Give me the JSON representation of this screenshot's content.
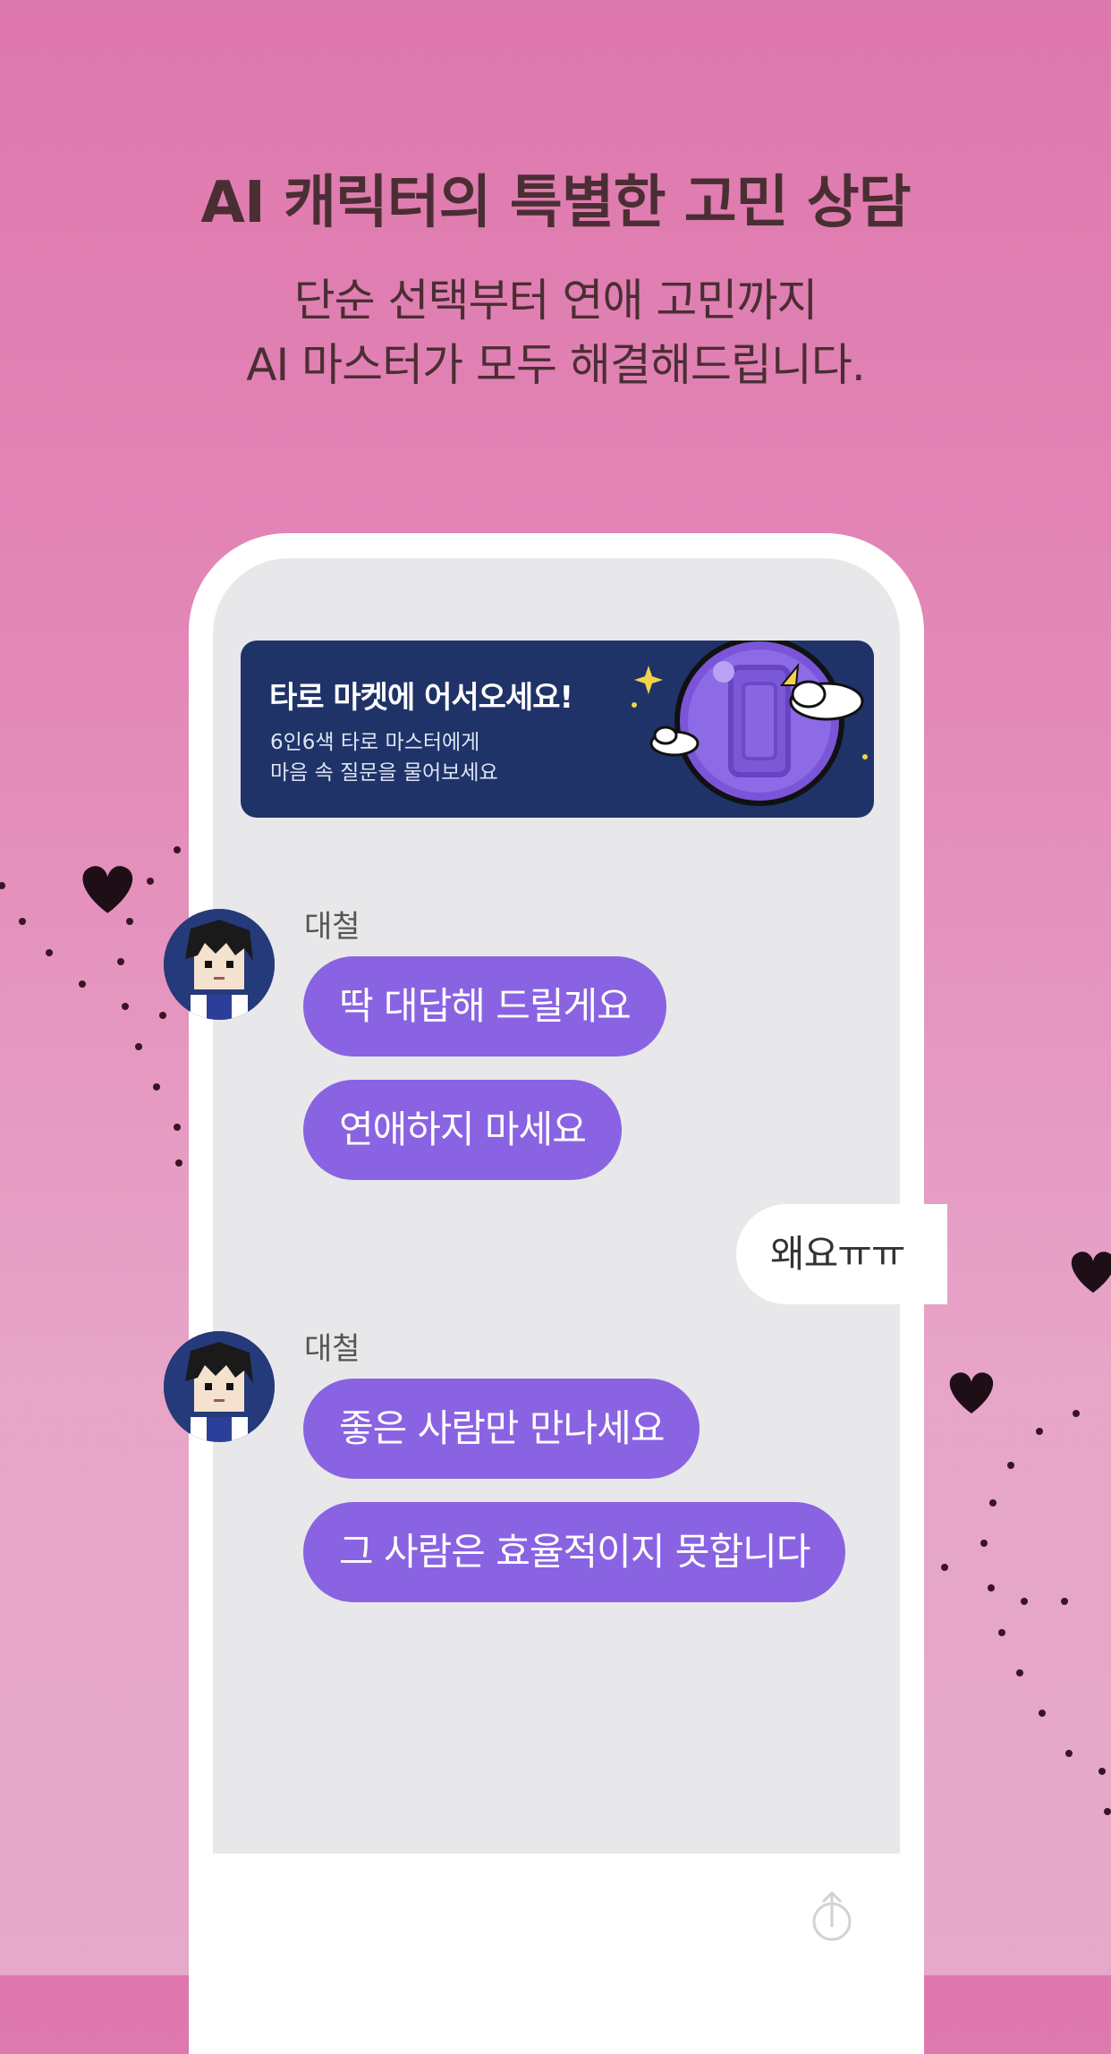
{
  "header": {
    "title": "AI 캐릭터의 특별한 고민 상담",
    "subtitle_line1": "단순 선택부터 연애 고민까지",
    "subtitle_line2": "AI 마스터가 모두 해결해드립니다."
  },
  "banner": {
    "title": "타로 마켓에 어서오세요!",
    "desc_line1": "6인6색 타로 마스터에게",
    "desc_line2": "마음 속 질문을 물어보세요"
  },
  "chat": {
    "group1": {
      "sender": "대철",
      "messages": [
        "딱 대답해 드릴게요",
        "연애하지 마세요"
      ]
    },
    "mine": "왜요ㅠㅠ",
    "group2": {
      "sender": "대철",
      "messages": [
        "좋은 사람만 만나세요",
        "그 사람은 효율적이지 못합니다"
      ]
    }
  },
  "colors": {
    "background": "#e389b8",
    "bubble": "#8a63e2",
    "banner": "#1f3369",
    "text": "#4a2e33"
  },
  "icons": {
    "composer": "upload-icon"
  }
}
